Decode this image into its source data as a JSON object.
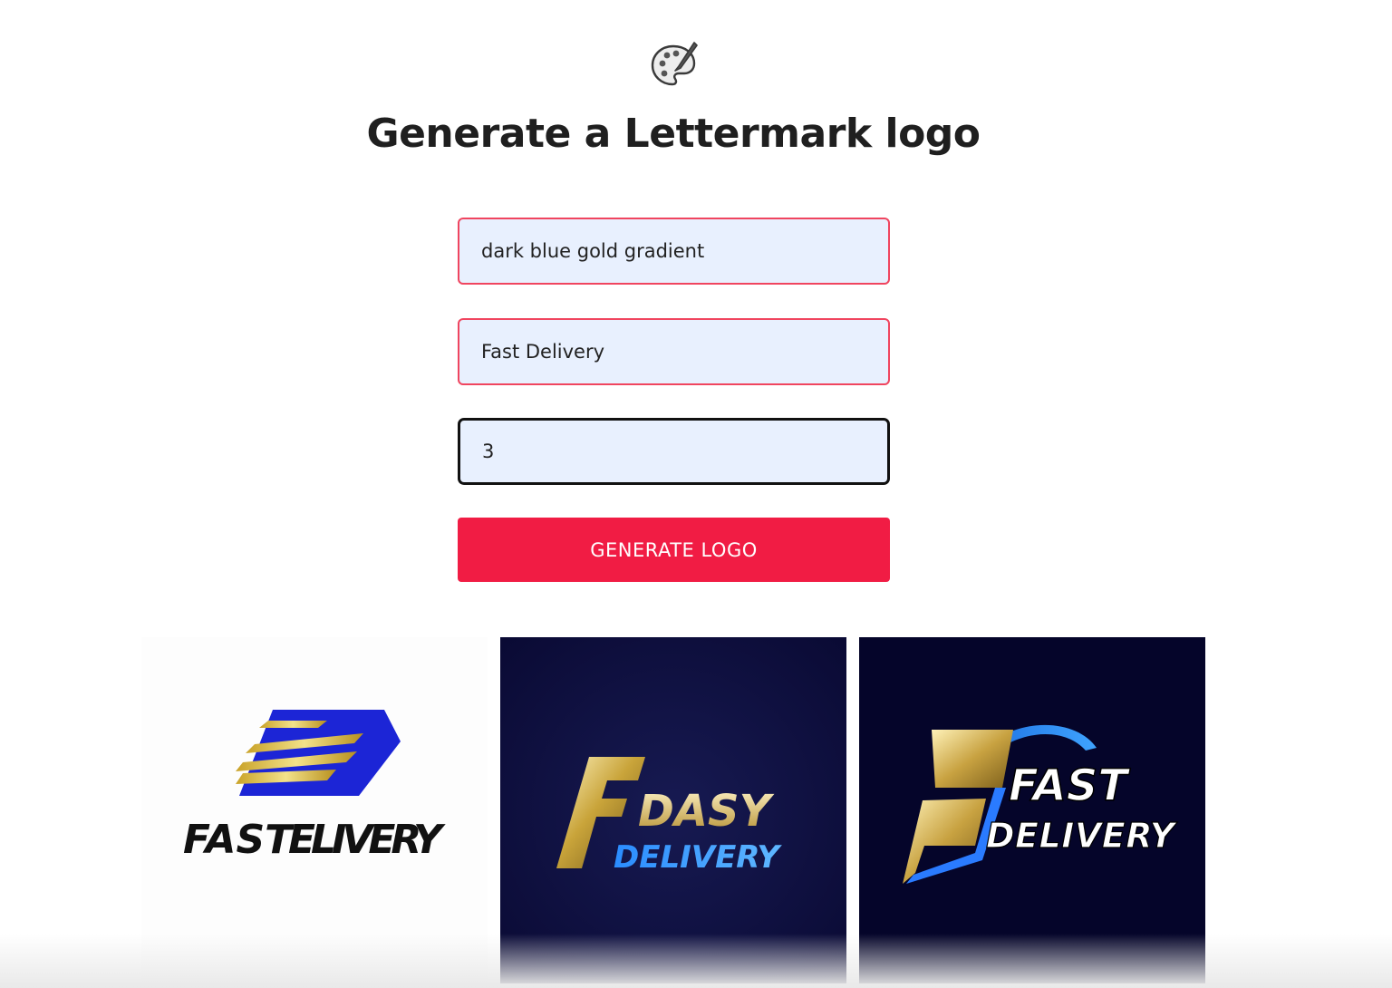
{
  "header": {
    "icon": "palette-icon",
    "title": "Generate a Lettermark logo"
  },
  "form": {
    "style_value": "dark blue gold gradient",
    "name_value": "Fast Delivery",
    "count_value": "3",
    "generate_label": "GENERATE LOGO"
  },
  "colors": {
    "accent": "#f11c44",
    "field_border": "#f0455f",
    "field_bg": "#e8f0fe"
  },
  "results": [
    {
      "line1": "FAST",
      "line2": "ELIVERY"
    },
    {
      "line1": "DASY",
      "line2": "DELIVERY"
    },
    {
      "line1": "FAST",
      "line2": "DELIVERY"
    }
  ]
}
